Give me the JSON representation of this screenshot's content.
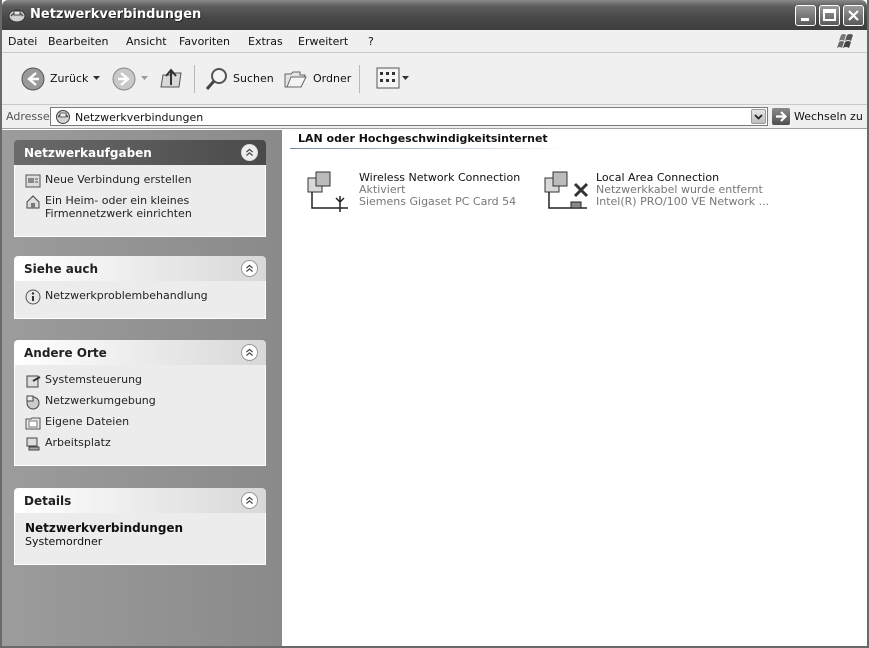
{
  "window": {
    "title": "Netzwerkverbindungen"
  },
  "menu": [
    "Datei",
    "Bearbeiten",
    "Ansicht",
    "Favoriten",
    "Extras",
    "Erweitert",
    "?"
  ],
  "toolbar": {
    "back": "Zurück",
    "search": "Suchen",
    "folders": "Ordner"
  },
  "address": {
    "label": "Adresse",
    "value": "Netzwerkverbindungen",
    "go": "Wechseln zu"
  },
  "taskpane": {
    "network_tasks": {
      "title": "Netzwerkaufgaben",
      "items": [
        "Neue Verbindung erstellen",
        "Ein Heim- oder ein kleines Firmennetzwerk einrichten"
      ]
    },
    "see_also": {
      "title": "Siehe auch",
      "items": [
        "Netzwerkproblembehandlung"
      ]
    },
    "other_places": {
      "title": "Andere Orte",
      "items": [
        "Systemsteuerung",
        "Netzwerkumgebung",
        "Eigene Dateien",
        "Arbeitsplatz"
      ]
    },
    "details": {
      "title": "Details",
      "name": "Netzwerkverbindungen",
      "type": "Systemordner"
    }
  },
  "content": {
    "group_header": "LAN oder Hochgeschwindigkeitsinternet",
    "connections": [
      {
        "name": "Wireless Network Connection",
        "status": "Aktiviert",
        "device": "Siemens Gigaset PC Card 54"
      },
      {
        "name": "Local Area Connection",
        "status": "Netzwerkkabel wurde entfernt",
        "device": "Intel(R) PRO/100 VE Network ..."
      }
    ]
  }
}
